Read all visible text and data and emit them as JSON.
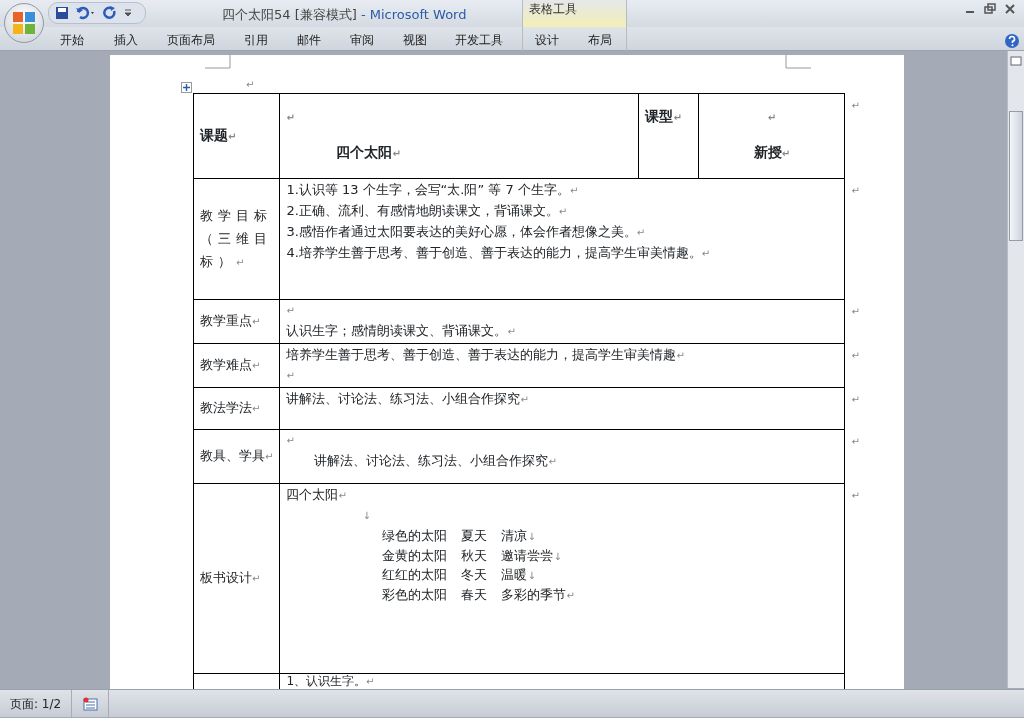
{
  "window": {
    "title_document": "四个太阳54 [兼容模式]",
    "title_app": "- Microsoft Word"
  },
  "ribbon_tabs": [
    {
      "label": "开始"
    },
    {
      "label": "插入"
    },
    {
      "label": "页面布局"
    },
    {
      "label": "引用"
    },
    {
      "label": "邮件"
    },
    {
      "label": "审阅"
    },
    {
      "label": "视图"
    },
    {
      "label": "开发工具"
    }
  ],
  "context_group": {
    "label": "表格工具",
    "tabs": [
      {
        "label": "设计"
      },
      {
        "label": "布局"
      }
    ]
  },
  "document": {
    "before_table": {
      "end": "↵"
    },
    "table": {
      "rows": [
        {
          "end": "↵",
          "cells": [
            {
              "paragraphs": [
                {
                  "text": "课题",
                  "end": "↵"
                }
              ]
            },
            {
              "paragraphs": [
                {
                  "end": "↵"
                },
                {
                  "text": "四个太阳",
                  "end": "↵"
                }
              ]
            },
            {
              "paragraphs": [
                {
                  "text": "课型",
                  "end": "↵"
                }
              ]
            },
            {
              "paragraphs": [
                {
                  "end": "↵"
                },
                {
                  "text": "新授",
                  "end": "↵"
                }
              ]
            }
          ]
        },
        {
          "end": "↵",
          "cells": [
            {
              "paragraphs": [
                {
                  "text": "教学目标（三维目标）",
                  "end": "↵"
                }
              ]
            },
            {
              "colspan": 3,
              "paragraphs": [
                {
                  "text": "1.认识等 13 个生字，会写“太.阳” 等 7 个生字。",
                  "end": "↵"
                },
                {
                  "text": "2.正确、流利、有感情地朗读课文，背诵课文。",
                  "end": "↵"
                },
                {
                  "text": "3.感悟作者通过太阳要表达的美好心愿，体会作者想像之美。",
                  "end": "↵"
                },
                {
                  "text": "4.培养学生善于思考、善于创造、善于表达的能力，提高学生审美情趣。",
                  "end": "↵"
                }
              ]
            }
          ]
        },
        {
          "end": "↵",
          "cells": [
            {
              "paragraphs": [
                {
                  "text": "教学重点",
                  "end": "↵"
                }
              ]
            },
            {
              "colspan": 3,
              "paragraphs": [
                {
                  "end": "↵"
                },
                {
                  "text": "认识生字；感情朗读课文、背诵课文。",
                  "end": "↵"
                }
              ]
            }
          ]
        },
        {
          "end": "↵",
          "cells": [
            {
              "paragraphs": [
                {
                  "text": "教学难点",
                  "end": "↵"
                }
              ]
            },
            {
              "colspan": 3,
              "paragraphs": [
                {
                  "text": "培养学生善于思考、善于创造、善于表达的能力，提高学生审美情趣",
                  "end": "↵"
                },
                {
                  "end": "↵"
                }
              ]
            }
          ]
        },
        {
          "end": "↵",
          "cells": [
            {
              "paragraphs": [
                {
                  "text": "教法学法",
                  "end": "↵"
                }
              ]
            },
            {
              "colspan": 3,
              "paragraphs": [
                {
                  "text": "讲解法、讨论法、练习法、小组合作探究",
                  "end": "↵"
                }
              ]
            }
          ]
        },
        {
          "end": "↵",
          "cells": [
            {
              "paragraphs": [
                {
                  "text": "教具、学具",
                  "end": "↵"
                }
              ]
            },
            {
              "colspan": 3,
              "paragraphs": [
                {
                  "end": "↵"
                },
                {
                  "text": "讲解法、讨论法、练习法、小组合作探究",
                  "end": "↵"
                }
              ]
            }
          ]
        },
        {
          "end": "↵",
          "cells": [
            {
              "paragraphs": [
                {
                  "text": "板书设计",
                  "end": "↵"
                }
              ]
            },
            {
              "colspan": 3,
              "paragraphs": [
                {
                  "text": "四个太阳",
                  "end": "↵"
                },
                {
                  "end": "↓"
                },
                {
                  "columns": [
                    "绿色的太阳",
                    "夏天",
                    "清凉"
                  ],
                  "end": "↓"
                },
                {
                  "columns": [
                    "金黄的太阳",
                    "秋天",
                    "邀请尝尝"
                  ],
                  "end": "↓"
                },
                {
                  "columns": [
                    "红红的太阳",
                    "冬天",
                    "温暖"
                  ],
                  "end": "↓"
                },
                {
                  "columns": [
                    "彩色的太阳",
                    "春天",
                    "多彩的季节"
                  ],
                  "end": "↵"
                }
              ]
            }
          ]
        },
        {
          "cells": [
            {},
            {
              "colspan": 3,
              "paragraphs": [
                {
                  "text": "1、认识生字。",
                  "end": "↵"
                }
              ]
            }
          ]
        }
      ]
    }
  },
  "status_bar": {
    "page": "页面: 1/2"
  }
}
